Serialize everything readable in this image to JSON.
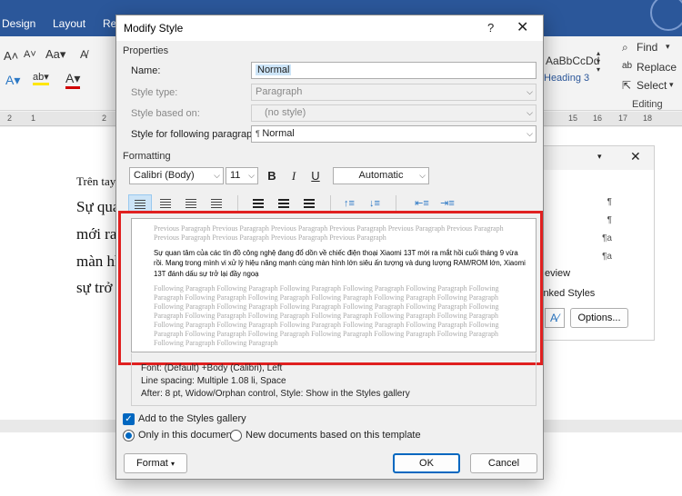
{
  "word": {
    "ribbon_tabs": [
      "Design",
      "Layout",
      "Re"
    ],
    "styles_gallery": {
      "sample": "AaBbCcDd",
      "heading": "Heading 3"
    },
    "editing": {
      "find": "Find",
      "replace": "Replace",
      "select": "Select",
      "group_label": "Editing"
    },
    "ruler_numbers": [
      "2",
      "1",
      "2",
      "15",
      "16",
      "17",
      "18"
    ],
    "document_lines": [
      "Trên tay",
      "Sự qua",
      "mới ra",
      "màn hì",
      "sự trở"
    ],
    "styles_pane": {
      "preview_label": "eview",
      "linked_label": "inked Styles",
      "options_button": "Options..."
    }
  },
  "dialog": {
    "title": "Modify Style",
    "help": "?",
    "close": "✕",
    "properties_header": "Properties",
    "name_label": "Name:",
    "name_value": "Normal",
    "style_type_label": "Style type:",
    "style_type_value": "Paragraph",
    "based_on_label": "Style based on:",
    "based_on_value": "(no style)",
    "following_label": "Style for following paragraph:",
    "following_value": "Normal",
    "formatting_header": "Formatting",
    "font": "Calibri (Body)",
    "size": "11",
    "bold": "B",
    "italic": "I",
    "underline": "U",
    "color": "Automatic",
    "preview_previous": "Previous Paragraph Previous Paragraph Previous Paragraph Previous Paragraph Previous Paragraph Previous Paragraph Previous Paragraph Previous Paragraph Previous Paragraph Previous Paragraph",
    "preview_text": "Sự quan tâm của các tín đồ công nghệ đang đổ dồn về chiếc điện thoại Xiaomi 13T mới ra mắt hồi cuối tháng 9 vừa rồi. Mang trong mình vi xử lý hiệu năng mạnh cùng màn hình lớn siêu ấn tượng và dung lượng RAM/ROM lớn, Xiaomi 13T đánh dấu sự trở lại đầy ngoạ",
    "preview_following": "Following Paragraph Following Paragraph Following Paragraph Following Paragraph Following Paragraph Following Paragraph Following Paragraph Following Paragraph Following Paragraph Following Paragraph Following Paragraph Following Paragraph Following Paragraph Following Paragraph Following Paragraph Following Paragraph Following Paragraph Following Paragraph Following Paragraph Following Paragraph Following Paragraph Following Paragraph Following Paragraph Following Paragraph Following Paragraph Following Paragraph Following Paragraph Following Paragraph Following Paragraph Following Paragraph Following Paragraph Following Paragraph Following Paragraph Following Paragraph Following Paragraph",
    "description": [
      "Font: (Default) +Body (Calibri), Left",
      "Line spacing:  Multiple 1.08 li, Space",
      "After:  8 pt, Widow/Orphan control, Style: Show in the Styles gallery"
    ],
    "add_to_gallery": "Add to the Styles gallery",
    "only_this_doc": "Only in this document",
    "new_docs": "New documents based on this template",
    "format_button": "Format",
    "ok_button": "OK",
    "cancel_button": "Cancel",
    "highlight_color": "#e02020",
    "accent_color": "#0067c0"
  }
}
